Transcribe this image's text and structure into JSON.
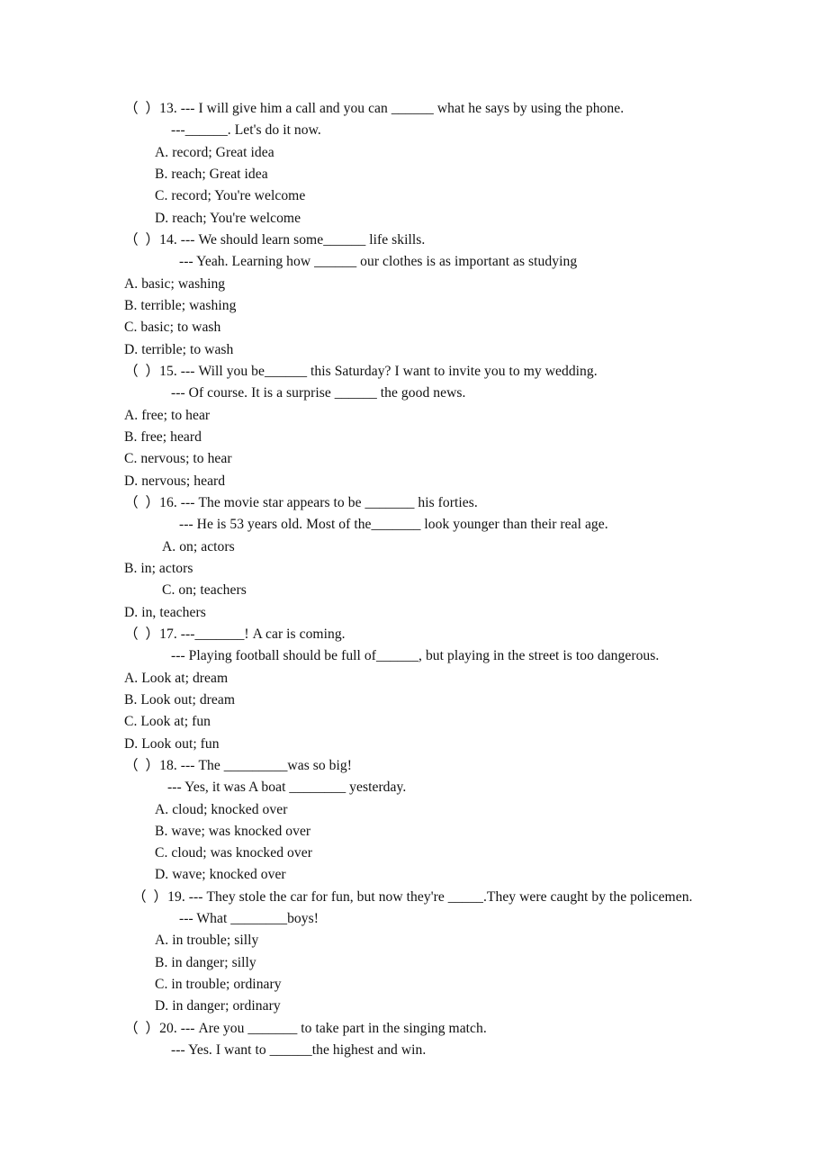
{
  "document": {
    "type": "english-grammar-worksheet",
    "page_background": "#ffffff",
    "text_color": "#111111"
  },
  "questions": [
    {
      "number": "13",
      "bracket": "（  ）",
      "stem": "（  ）13. --- I will give him a call and you can ______ what he says by using the phone.",
      "reply": "---______. Let's do it now.",
      "options": [
        "A. record; Great idea",
        "B. reach; Great idea",
        "C. record; You're welcome",
        "D. reach; You're welcome"
      ]
    },
    {
      "number": "14",
      "bracket": "（  ）",
      "stem": "（  ）14. --- We should learn some______ life skills.",
      "reply": "--- Yeah. Learning how ______ our clothes is as important as studying",
      "options": [
        "A. basic; washing",
        "B. terrible; washing",
        "C. basic; to wash",
        "D. terrible; to wash"
      ]
    },
    {
      "number": "15",
      "bracket": "（  ）",
      "stem": "（  ）15. --- Will you be______ this Saturday? I want to invite you to my wedding.",
      "reply": "--- Of course. It is a surprise ______ the good news.",
      "options": [
        "A. free; to hear",
        "B. free; heard",
        "C. nervous; to hear",
        "D. nervous; heard"
      ]
    },
    {
      "number": "16",
      "bracket": "（  ）",
      "stem": "（  ）16. --- The movie star appears to be _______ his forties.",
      "reply": "--- He is 53 years old. Most of the_______ look younger than their real age.",
      "options": [
        "A. on; actors",
        "B. in; actors",
        "C. on; teachers",
        "D. in, teachers"
      ]
    },
    {
      "number": "17",
      "bracket": "（  ）",
      "stem": "（  ）17. ---_______! A car is coming.",
      "reply": "--- Playing football should be full of______, but playing in the street is too dangerous.",
      "options": [
        "A. Look at; dream",
        "B. Look out; dream",
        "C. Look at; fun",
        "D. Look out; fun"
      ]
    },
    {
      "number": "18",
      "bracket": "（  ）",
      "stem": "（  ）18. --- The _________was so big!",
      "reply": "--- Yes, it was A boat ________ yesterday.",
      "options": [
        "A. cloud; knocked over",
        "B. wave; was knocked over",
        "C. cloud; was knocked over",
        "D. wave; knocked over"
      ]
    },
    {
      "number": "19",
      "bracket": "（  ）",
      "stem": "（  ）19. --- They stole the car for fun, but now they're _____.They were caught by the policemen.",
      "reply": "--- What ________boys!",
      "options": [
        "A. in trouble; silly",
        "B. in danger; silly",
        "C. in trouble; ordinary",
        "D. in danger; ordinary"
      ]
    },
    {
      "number": "20",
      "bracket": "（  ）",
      "stem": "（  ）20. --- Are you _______ to take part in the singing match.",
      "reply": "--- Yes. I want to ______the highest and win.",
      "options": []
    }
  ]
}
